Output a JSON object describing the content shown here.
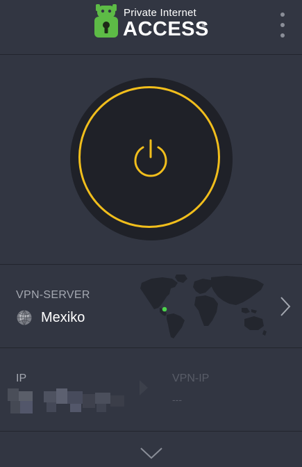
{
  "header": {
    "brand_top": "Private Internet",
    "brand_main": "ACCESS",
    "brand_reg": "®",
    "menu_icon": "more-vertical-icon"
  },
  "power": {
    "icon": "power-icon",
    "ring_color": "#f1be1c",
    "state": "disconnected"
  },
  "server": {
    "label": "VPN-SERVER",
    "name": "Mexiko",
    "flag_icon": "globe-icon",
    "map_icon": "world-map",
    "marker_color": "#4cd34c",
    "chevron_icon": "chevron-right-icon"
  },
  "ip": {
    "label": "IP",
    "value_redacted": true,
    "arrow_icon": "arrow-right-icon",
    "vpn_ip_label": "VPN-IP",
    "vpn_ip_value": "---"
  },
  "footer": {
    "expand_icon": "chevron-down-icon"
  },
  "colors": {
    "background": "#323642",
    "accent": "#f1be1c",
    "brand_green": "#5dbb46",
    "text_secondary": "#a4a8b1",
    "text_disabled": "#585c67"
  }
}
